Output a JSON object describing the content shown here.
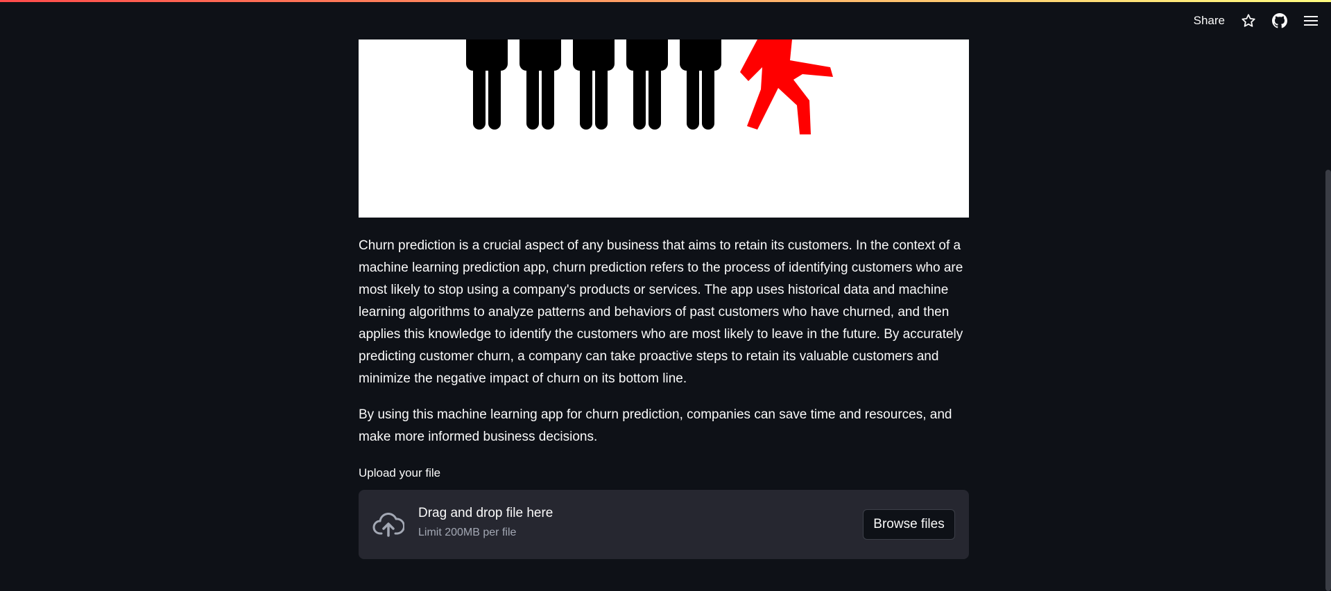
{
  "header": {
    "share_label": "Share",
    "icons": [
      "star-icon",
      "github-icon",
      "hamburger-menu-icon"
    ]
  },
  "colors": {
    "background": "#0e1117",
    "decoration_start": "#ff4b4b",
    "decoration_end": "#fffd80",
    "dropzone_bg": "#262730",
    "churner_red": "#ff0000"
  },
  "main": {
    "paragraph_1": "Churn prediction is a crucial aspect of any business that aims to retain its customers. In the context of a machine learning prediction app, churn prediction refers to the process of identifying customers who are most likely to stop using a company's products or services. The app uses historical data and machine learning algorithms to analyze patterns and behaviors of past customers who have churned, and then applies this knowledge to identify the customers who are most likely to leave in the future. By accurately predicting customer churn, a company can take proactive steps to retain its valuable customers and minimize the negative impact of churn on its bottom line.",
    "paragraph_2": "By using this machine learning app for churn prediction, companies can save time and resources, and make more informed business decisions.",
    "uploader": {
      "label": "Upload your file",
      "title": "Drag and drop file here",
      "limit": "Limit 200MB per file",
      "button_label": "Browse files",
      "icon": "cloud-upload-icon"
    }
  }
}
